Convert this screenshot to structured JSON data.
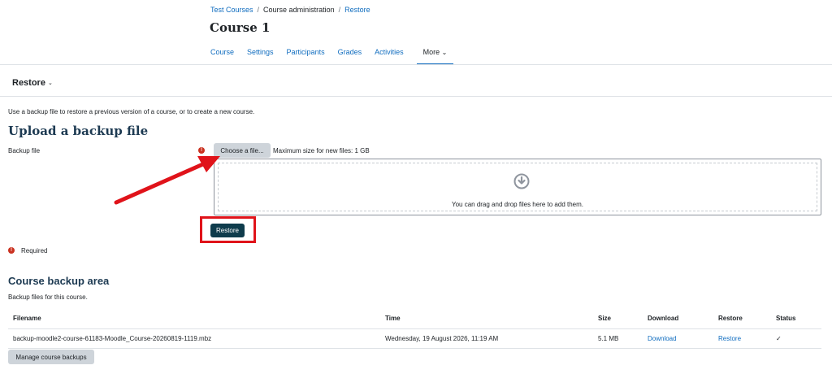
{
  "breadcrumb": [
    {
      "label": "Test Courses",
      "link": true
    },
    {
      "label": "Course administration",
      "link": false
    },
    {
      "label": "Restore",
      "link": true
    }
  ],
  "breadcrumb_separator": "/",
  "course": {
    "title": "Course 1"
  },
  "course_nav": {
    "tabs": [
      "Course",
      "Settings",
      "Participants",
      "Grades",
      "Activities"
    ],
    "more_label": "More",
    "more_caret": "⌄"
  },
  "restore_menu": {
    "label": "Restore",
    "caret": "⌄"
  },
  "intro_text": "Use a backup file to restore a previous version of a course, or to create a new course.",
  "upload": {
    "heading": "Upload a backup file",
    "field_label": "Backup file",
    "required_icon": "!",
    "choose_label": "Choose a file...",
    "max_size": "Maximum size for new files: 1 GB",
    "drop_text": "You can drag and drop files here to add them.",
    "drop_icon": "download-arrow-icon",
    "restore_button": "Restore",
    "required_label": "Required"
  },
  "backup_area": {
    "heading": "Course backup area",
    "description": "Backup files for this course.",
    "columns": [
      "Filename",
      "Time",
      "Size",
      "Download",
      "Restore",
      "Status"
    ],
    "rows": [
      {
        "filename": "backup-moodle2-course-61183-Moodle_Course-20260819-1119.mbz",
        "time": "Wednesday, 19 August 2026, 11:19 AM",
        "size": "5.1 MB",
        "download": "Download",
        "restore": "Restore",
        "status": "✓"
      }
    ],
    "manage_button": "Manage course backups"
  },
  "colors": {
    "link": "#0f6cbf",
    "primary_button": "#0f3c4c",
    "annotation": "#e0131a",
    "required": "#ca3120"
  }
}
